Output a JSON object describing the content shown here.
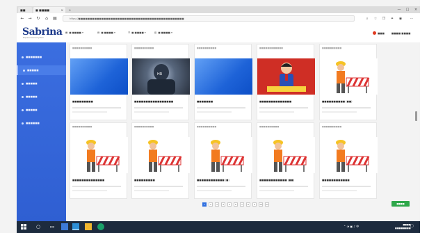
{
  "browser": {
    "tabs": [
      {
        "label": "■ ■■■■"
      },
      {
        "label": "×"
      }
    ],
    "new_tab": "+",
    "url": "https://■■■■■■■■■■■■■■■■■■■■■■■■■■■■■■■■■■■■■■■■■■■■■■",
    "win_min": "—",
    "win_max": "□",
    "win_close": "×"
  },
  "app": {
    "logo": "Sabrina",
    "logo_sub": "Express Service System",
    "nav": [
      "■ ■■■■ ▾",
      "■ ■■■■ ▾",
      "■ ■■■■ ▾",
      "■ ■■■■ ▾"
    ],
    "user_status": "■■■",
    "user_name": "■■■■ ■■■■"
  },
  "sidebar": {
    "items": [
      {
        "label": "■■■■■■■"
      },
      {
        "label": "■■■■■"
      },
      {
        "label": "■■■■■"
      },
      {
        "label": "■■■■■"
      },
      {
        "label": "■■■■■"
      },
      {
        "label": "■■■■■■"
      }
    ]
  },
  "cards": [
    {
      "header": "■■■■■■■■■■",
      "title": "■■■■■■■■■"
    },
    {
      "header": "■■■■■■■■■■",
      "title": "■■■■■■■■■■■■■■■■■"
    },
    {
      "header": "■■■■■■■■■■",
      "title": "■■■■■■■"
    },
    {
      "header": "■■■■■■■■■■■■",
      "title": "■■■■■■■■■■■■■■"
    },
    {
      "header": "■■■■■■■■■■",
      "title": "■■■■■■■■■■ (■■)"
    },
    {
      "header": "■■■■■■■■■■",
      "title": "■■■■■■■■■■■■■■"
    },
    {
      "header": "■■■■■■■■■■",
      "title": "■■■■■■■■■"
    },
    {
      "header": "■■■■■■■■■■",
      "title": "■■■■■■■■■■■■ (■)"
    },
    {
      "header": "■■■■■■■■■■",
      "title": "■■■■■■■■■■■■ (■■)"
    },
    {
      "header": "■■■■■■■■■■",
      "title": "■■■■■■■■■■■■"
    }
  ],
  "pager": {
    "pages": [
      "1",
      "2",
      "3",
      "4",
      "5",
      "6",
      "7",
      "8",
      "9",
      "10",
      "11"
    ],
    "current": "1"
  },
  "action": {
    "label": "■■■■"
  },
  "taskbar": {
    "clock_time": "■■■■",
    "clock_date": "■■■■■■■■"
  },
  "colors": {
    "sidebar": "#3b6ee0",
    "accent": "#2f6fe0",
    "green": "#2ea84a",
    "taskbar": "#1d2b3e"
  }
}
